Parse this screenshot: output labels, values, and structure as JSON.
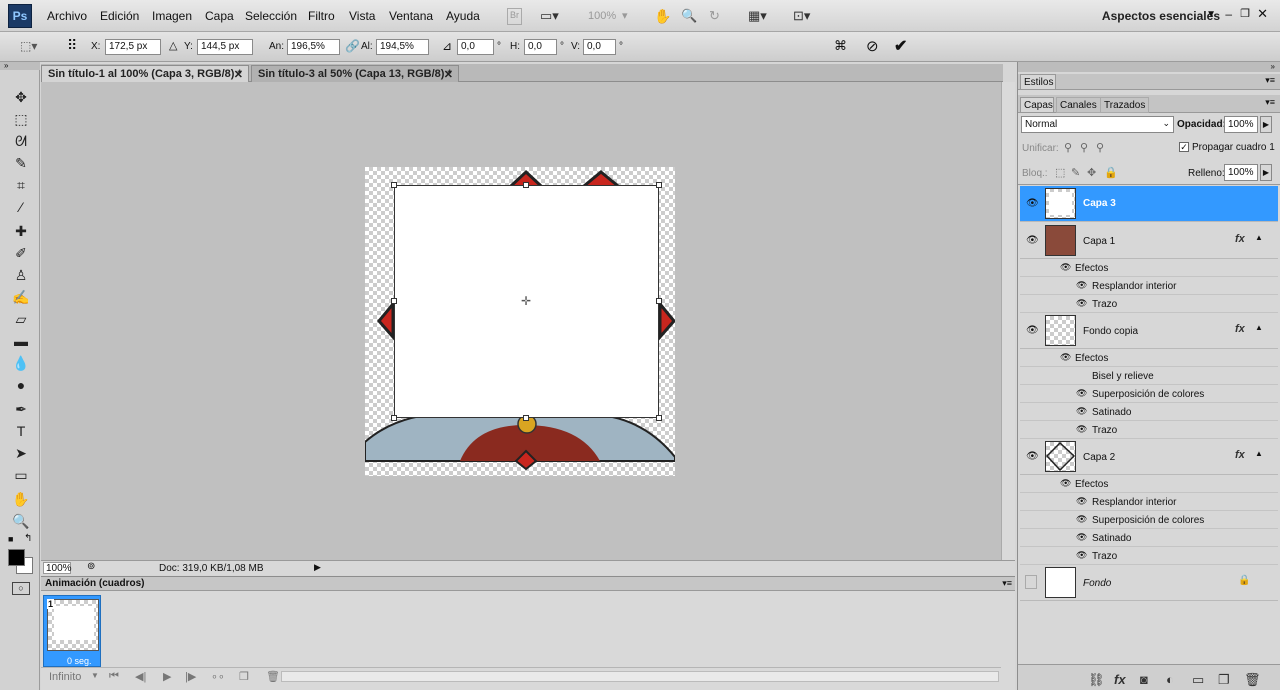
{
  "app": {
    "logo": "Ps"
  },
  "menu": [
    "Archivo",
    "Edición",
    "Imagen",
    "Capa",
    "Selección",
    "Filtro",
    "Vista",
    "Ventana",
    "Ayuda"
  ],
  "menubar_tools": {
    "br": "Br",
    "zoom": "100%",
    "workspace": "Aspectos esenciales"
  },
  "options": {
    "x_label": "X:",
    "x_value": "172,5 px",
    "y_label": "Y:",
    "y_value": "144,5 px",
    "w_label": "An:",
    "w_value": "196,5%",
    "h_label": "Al:",
    "h_value": "194,5%",
    "angle_value": "0,0",
    "angle_unit": "°",
    "hskew_label": "H:",
    "hskew_value": "0,0",
    "hskew_unit": "°",
    "vskew_label": "V:",
    "vskew_value": "0,0",
    "vskew_unit": "°"
  },
  "tabs": [
    {
      "label": "Sin título-1 al 100% (Capa 3, RGB/8) *",
      "active": true
    },
    {
      "label": "Sin título-3 al 50% (Capa 13, RGB/8) *",
      "active": false
    }
  ],
  "status": {
    "zoom": "100%",
    "doc": "Doc: 319,0 KB/1,08 MB"
  },
  "animation": {
    "title": "Animación (cuadros)",
    "frame_number": "1",
    "frame_delay": "0 seg.",
    "loop": "Infinito"
  },
  "right": {
    "styles_tab": "Estilos",
    "panel_tabs": [
      "Capas",
      "Canales",
      "Trazados"
    ],
    "blend_mode": "Normal",
    "opacity_label": "Opacidad:",
    "opacity_value": "100%",
    "unify_label": "Unificar:",
    "propagate_label": "Propagar cuadro 1",
    "lock_label": "Bloq.:",
    "fill_label": "Relleno:",
    "fill_value": "100%",
    "layers": [
      {
        "name": "Capa 3",
        "selected": true,
        "fx": false
      },
      {
        "name": "Capa 1",
        "selected": false,
        "fx": true,
        "effects_label": "Efectos",
        "effects": [
          "Resplandor interior",
          "Trazo"
        ]
      },
      {
        "name": "Fondo copia",
        "selected": false,
        "fx": true,
        "effects_label": "Efectos",
        "effects": [
          "Bisel y relieve",
          "Superposición de colores",
          "Satinado",
          "Trazo"
        ]
      },
      {
        "name": "Capa 2",
        "selected": false,
        "fx": true,
        "effects_label": "Efectos",
        "effects": [
          "Resplandor interior",
          "Superposición de colores",
          "Satinado",
          "Trazo"
        ]
      },
      {
        "name": "Fondo",
        "selected": false,
        "fx": false,
        "locked": true
      }
    ],
    "fx_label": "fx"
  },
  "colors": {
    "accent": "#3399ff",
    "fg": "#000000",
    "bg": "#ffffff"
  }
}
